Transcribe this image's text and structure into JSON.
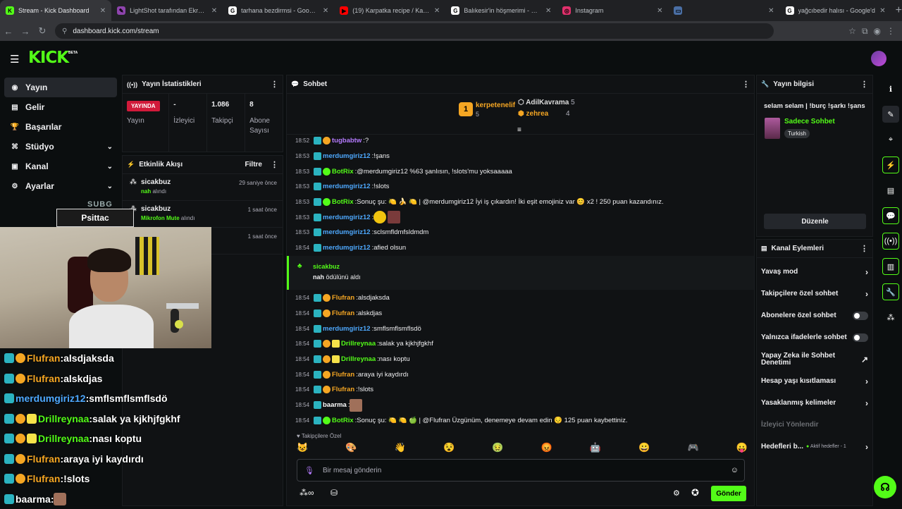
{
  "browser": {
    "tabs": [
      {
        "title": "Stream - Kick Dashboard",
        "fav": "K",
        "color": "#53fc18"
      },
      {
        "title": "LightShot tarafından Ekran Gör",
        "fav": "✎",
        "color": "#8e44ad"
      },
      {
        "title": "tarhana bezdirmsi - Google'da",
        "fav": "G",
        "color": "#ffffff"
      },
      {
        "title": "(19) Karpatka recipe / Karpatka",
        "fav": "▶",
        "color": "#ff0000"
      },
      {
        "title": "Balıkesir'in höşmerimi - Google",
        "fav": "G",
        "color": "#ffffff"
      },
      {
        "title": "Instagram",
        "fav": "◎",
        "color": "#e1306c"
      },
      {
        "title": "",
        "fav": "▭",
        "color": "#4a6fa5"
      },
      {
        "title": "yağcıbedir halısı - Google'd",
        "fav": "G",
        "color": "#ffffff"
      }
    ],
    "url": "dashboard.kick.com/stream"
  },
  "nav": [
    {
      "label": "Yayın",
      "icon": "◉",
      "chev": ""
    },
    {
      "label": "Gelir",
      "icon": "▤",
      "chev": ""
    },
    {
      "label": "Başarılar",
      "icon": "🏆",
      "chev": ""
    },
    {
      "label": "Stüdyo",
      "icon": "⌘",
      "chev": "⌄"
    },
    {
      "label": "Kanal",
      "icon": "▣",
      "chev": "⌄"
    },
    {
      "label": "Ayarlar",
      "icon": "⚙",
      "chev": "⌄"
    }
  ],
  "stats": {
    "title": "Yayın İstatistikleri",
    "live": "YAYINDA",
    "broadcast_label": "Yayın",
    "viewers_value": "-",
    "viewers_label": "İzleyici",
    "followers_value": "1.086",
    "followers_label": "Takipçi",
    "subs_value": "8",
    "subs_label": "Abone Sayısı"
  },
  "activity": {
    "title": "Etkinlik Akışı",
    "filter": "Filtre",
    "items": [
      {
        "name": "sicakbuz",
        "reward": "nah",
        "suffix": "alındı",
        "time": "29 saniye önce"
      },
      {
        "name": "sicakbuz",
        "reward": "Mikrofon Mute",
        "suffix": "alındı",
        "time": "1 saat önce"
      },
      {
        "name": "",
        "reward": "",
        "suffix": "",
        "time": "1 saat önce"
      }
    ]
  },
  "overlay": {
    "banner": "Psittac",
    "subg": "SUBG",
    "chat": [
      {
        "user": "Flufran",
        "text": "alsdjaksda",
        "color": "#f5a623"
      },
      {
        "user": "Flufran",
        "text": "alskdjas",
        "color": "#f5a623"
      },
      {
        "user": "merdumgiriz12",
        "text": "smflsmflsmflsdö",
        "color": "#4ea9ff"
      },
      {
        "user": "Drillreynaa",
        "text": "salak ya kjkhjfgkhf",
        "color": "#53fc18"
      },
      {
        "user": "Drillreynaa",
        "text": "nası koptu",
        "color": "#53fc18"
      },
      {
        "user": "Flufran",
        "text": "araya iyi kaydırdı",
        "color": "#f5a623"
      },
      {
        "user": "Flufran",
        "text": "!slots",
        "color": "#f5a623"
      },
      {
        "user": "baarma",
        "text": "",
        "color": "#ffffff"
      }
    ]
  },
  "chat": {
    "title": "Sohbet",
    "top": [
      {
        "rank": "1",
        "name": "kerpetenelif",
        "count": "5"
      },
      {
        "rank": "",
        "name": "AdilKavrama",
        "count": "5"
      },
      {
        "rank": "",
        "name": "zehrea",
        "count": "4"
      }
    ],
    "messages": [
      {
        "ts": "18:52",
        "user": "tugbabtw",
        "text": "?",
        "color": "#b57bff"
      },
      {
        "ts": "18:53",
        "user": "merdumgiriz12",
        "text": "!şans",
        "color": "#4ea9ff"
      },
      {
        "ts": "18:53",
        "user": "BotRix",
        "text": "@merdumgiriz12 %63 şanlısın, !slots'mu yoksaaaaa",
        "color": "#53fc18"
      },
      {
        "ts": "18:53",
        "user": "merdumgiriz12",
        "text": "!slots",
        "color": "#4ea9ff"
      },
      {
        "ts": "18:53",
        "user": "BotRix",
        "text": "Sonuç şu: 🍋 🍌 🍋 | @merdumgiriz12 İyi iş çıkardın! İki eşit emojiniz var 😊 x2 ! 250 puan kazandınız.",
        "color": "#53fc18"
      },
      {
        "ts": "18:53",
        "user": "merdumgiriz12",
        "text": "",
        "color": "#4ea9ff"
      },
      {
        "ts": "18:53",
        "user": "merdumgiriz12",
        "text": "sclsmfldmfsldmdm",
        "color": "#4ea9ff"
      },
      {
        "ts": "18:54",
        "user": "merdumgiriz12",
        "text": "afied olsun",
        "color": "#4ea9ff"
      }
    ],
    "reward": {
      "user": "sicakbuz",
      "reward": "nah",
      "suffix": "ödülünü aldı"
    },
    "messages2": [
      {
        "ts": "18:54",
        "user": "Flufran",
        "text": "alsdjaksda",
        "color": "#f5a623"
      },
      {
        "ts": "18:54",
        "user": "Flufran",
        "text": "alskdjas",
        "color": "#f5a623"
      },
      {
        "ts": "18:54",
        "user": "merdumgiriz12",
        "text": "smflsmflsmflsdö",
        "color": "#4ea9ff"
      },
      {
        "ts": "18:54",
        "user": "Drillreynaa",
        "text": "salak ya kjkhjfgkhf",
        "color": "#53fc18"
      },
      {
        "ts": "18:54",
        "user": "Drillreynaa",
        "text": "nası koptu",
        "color": "#53fc18"
      },
      {
        "ts": "18:54",
        "user": "Flufran",
        "text": "araya iyi kaydırdı",
        "color": "#f5a623"
      },
      {
        "ts": "18:54",
        "user": "Flufran",
        "text": "!slots",
        "color": "#f5a623"
      },
      {
        "ts": "18:54",
        "user": "baarma",
        "text": "",
        "color": "#ffffff"
      },
      {
        "ts": "18:54",
        "user": "BotRix",
        "text": "Sonuç şu: 🍋 🍋 🍏 | @Flufran Üzgünüm, denemeye devam edin 😔 125 puan kaybettiniz.",
        "color": "#53fc18"
      }
    ],
    "followers_only": "Takipçilere Özel",
    "emotes": [
      "😺",
      "🎨",
      "👋",
      "😵",
      "🤢",
      "😡",
      "🤖",
      "😀",
      "🎮",
      "😛"
    ],
    "placeholder": "Bir mesaj gönderin",
    "send": "Gönder"
  },
  "info": {
    "title": "Yayın bilgisi",
    "stream_title": "selam selam | !burç !şarkı !şans",
    "category": "Sadece Sohbet",
    "language": "Turkish",
    "edit": "Düzenle"
  },
  "actions": {
    "title": "Kanal Eylemleri",
    "items": [
      {
        "label": "Yavaş mod",
        "kind": "chev"
      },
      {
        "label": "Takipçilere özel sohbet",
        "kind": "chev"
      },
      {
        "label": "Abonelere özel sohbet",
        "kind": "toggle"
      },
      {
        "label": "Yalnızca ifadelerle sohbet",
        "kind": "toggle"
      },
      {
        "label": "Yapay Zeka ile Sohbet Denetimi",
        "kind": "ext"
      },
      {
        "label": "Hesap yaşı kısıtlaması",
        "kind": "chev"
      },
      {
        "label": "Yasaklanmış kelimeler",
        "kind": "chev"
      },
      {
        "label": "İzleyici Yönlendir",
        "kind": "none"
      },
      {
        "label": "Hedefleri b...",
        "kind": "goal",
        "extra": "Aktif hedefler - 1"
      }
    ]
  }
}
